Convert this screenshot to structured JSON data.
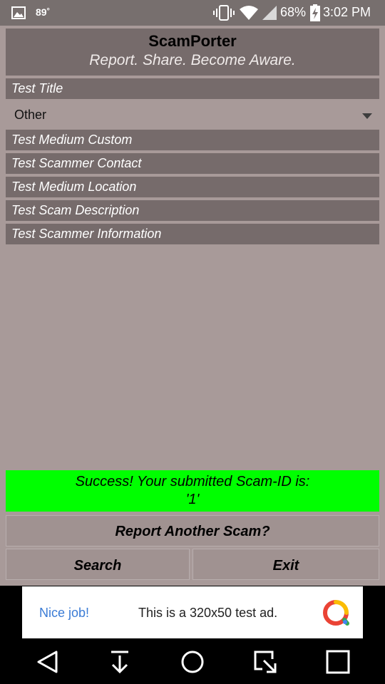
{
  "status_bar": {
    "temperature": "89˚",
    "battery_percent": "68%",
    "time": "3:02 PM"
  },
  "header": {
    "title": "ScamPorter",
    "subtitle": "Report. Share. Become Aware."
  },
  "form": {
    "title_value": "Test Title",
    "medium_selected": "Other",
    "medium_custom_value": "Test Medium Custom",
    "scammer_contact_value": "Test Scammer Contact",
    "medium_location_value": "Test Medium Location",
    "scam_description_value": "Test Scam Description",
    "scammer_information_value": "Test Scammer Information"
  },
  "success": {
    "line1": "Success! Your submitted Scam-ID is:",
    "line2": "'1'"
  },
  "buttons": {
    "report_another": "Report Another Scam?",
    "search": "Search",
    "exit": "Exit"
  },
  "ad": {
    "nice_job": "Nice job!",
    "text": "This is a 320x50 test ad."
  },
  "icons": {
    "status": [
      "image-icon",
      "vibrate-icon",
      "wifi-icon",
      "signal-icon",
      "battery-charging-icon"
    ],
    "nav": [
      "back-icon",
      "download-icon",
      "home-icon",
      "recents-icon",
      "overview-icon"
    ]
  },
  "colors": {
    "background": "#a89a99",
    "panel": "#766b6b",
    "success": "#00ff00",
    "ad_link": "#3a7bd5"
  }
}
